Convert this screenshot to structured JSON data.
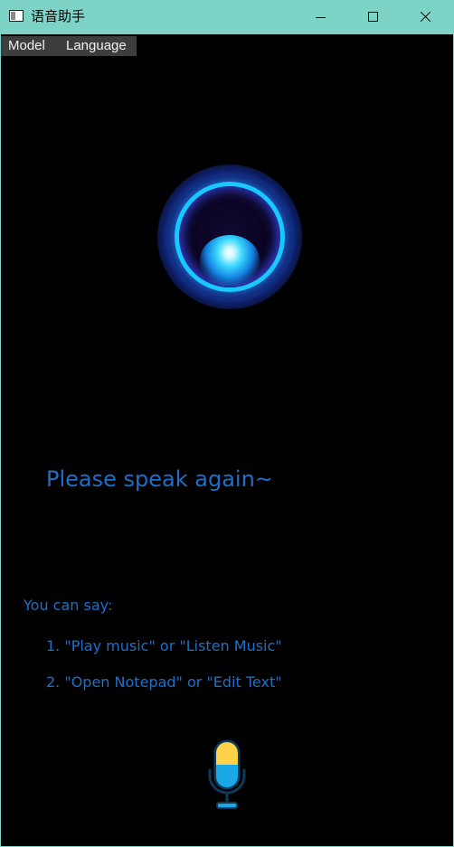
{
  "window": {
    "title": "语音助手"
  },
  "menu": {
    "items": [
      {
        "label": "Model"
      },
      {
        "label": "Language"
      }
    ]
  },
  "status": {
    "message": "Please speak again~"
  },
  "hints": {
    "title": "You can say:",
    "items": [
      {
        "text": "1. \"Play music\" or \"Listen Music\""
      },
      {
        "text": "2. \"Open Notepad\" or \"Edit Text\""
      }
    ]
  },
  "icons": {
    "app": "window-app-icon",
    "orb": "voice-orb-icon",
    "mic": "microphone-icon"
  },
  "colors": {
    "titlebar": "#7ed3c7",
    "background": "#000000",
    "text_accent": "#1f6fc8",
    "menubar": "#3d3d3d",
    "mic_top": "#ffd24a",
    "mic_bottom": "#1aa8e8"
  }
}
